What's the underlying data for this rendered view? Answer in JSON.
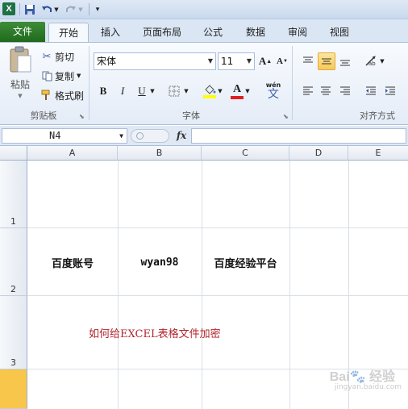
{
  "app": {
    "logo_letter": "X"
  },
  "ribbon_tabs": [
    {
      "label": "文件"
    },
    {
      "label": "开始"
    },
    {
      "label": "插入"
    },
    {
      "label": "页面布局"
    },
    {
      "label": "公式"
    },
    {
      "label": "数据"
    },
    {
      "label": "审阅"
    },
    {
      "label": "视图"
    }
  ],
  "clipboard": {
    "paste_label": "粘贴",
    "cut_label": "剪切",
    "copy_label": "复制",
    "format_painter_label": "格式刷",
    "group_label": "剪贴板"
  },
  "font": {
    "name": "宋体",
    "size": "11",
    "group_label": "字体",
    "bold": "B",
    "italic": "I",
    "underline": "U",
    "grow": "A",
    "shrink": "A",
    "font_color_letter": "A",
    "phonetic_label": "wén",
    "phonetic_char": "文"
  },
  "alignment": {
    "group_label": "对齐方式"
  },
  "formula_bar": {
    "name_box": "N4",
    "fx": "fx",
    "formula": ""
  },
  "sheet": {
    "columns": [
      "A",
      "B",
      "C",
      "D",
      "E"
    ],
    "rows": [
      "1",
      "2",
      "3",
      ""
    ],
    "cells": {
      "A2": "百度账号",
      "B2": "wyan98",
      "C2": "百度经验平台",
      "A3": "如何给EXCEL表格文件加密"
    }
  },
  "colors": {
    "file_tab": "#2e7d32",
    "selected_row_header": "#f7c64a",
    "red_text": "#b2232b"
  }
}
